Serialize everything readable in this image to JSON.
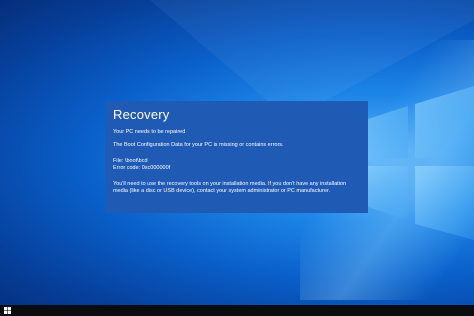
{
  "dialog": {
    "title": "Recovery",
    "subtitle": "Your PC needs to be repaired",
    "message": "The Boot Configuration Data for your PC is missing or contains errors.",
    "file": "File: \\boot\\bcd",
    "error_code": "Error code: 0xc000000f",
    "instructions_line1": "You'll need to use the recovery tools on your installation media. If you don't have any installation",
    "instructions_line2": "media (like a disc or USB device), contact your system administrator or PC manufacturer."
  },
  "colors": {
    "dialog_background": "#1f5bb4",
    "desktop_blue": "#0a5fc9",
    "taskbar": "#0b0c10"
  },
  "icons": {
    "start": "windows-logo-icon",
    "wallpaper_logo": "windows-logo-icon"
  }
}
